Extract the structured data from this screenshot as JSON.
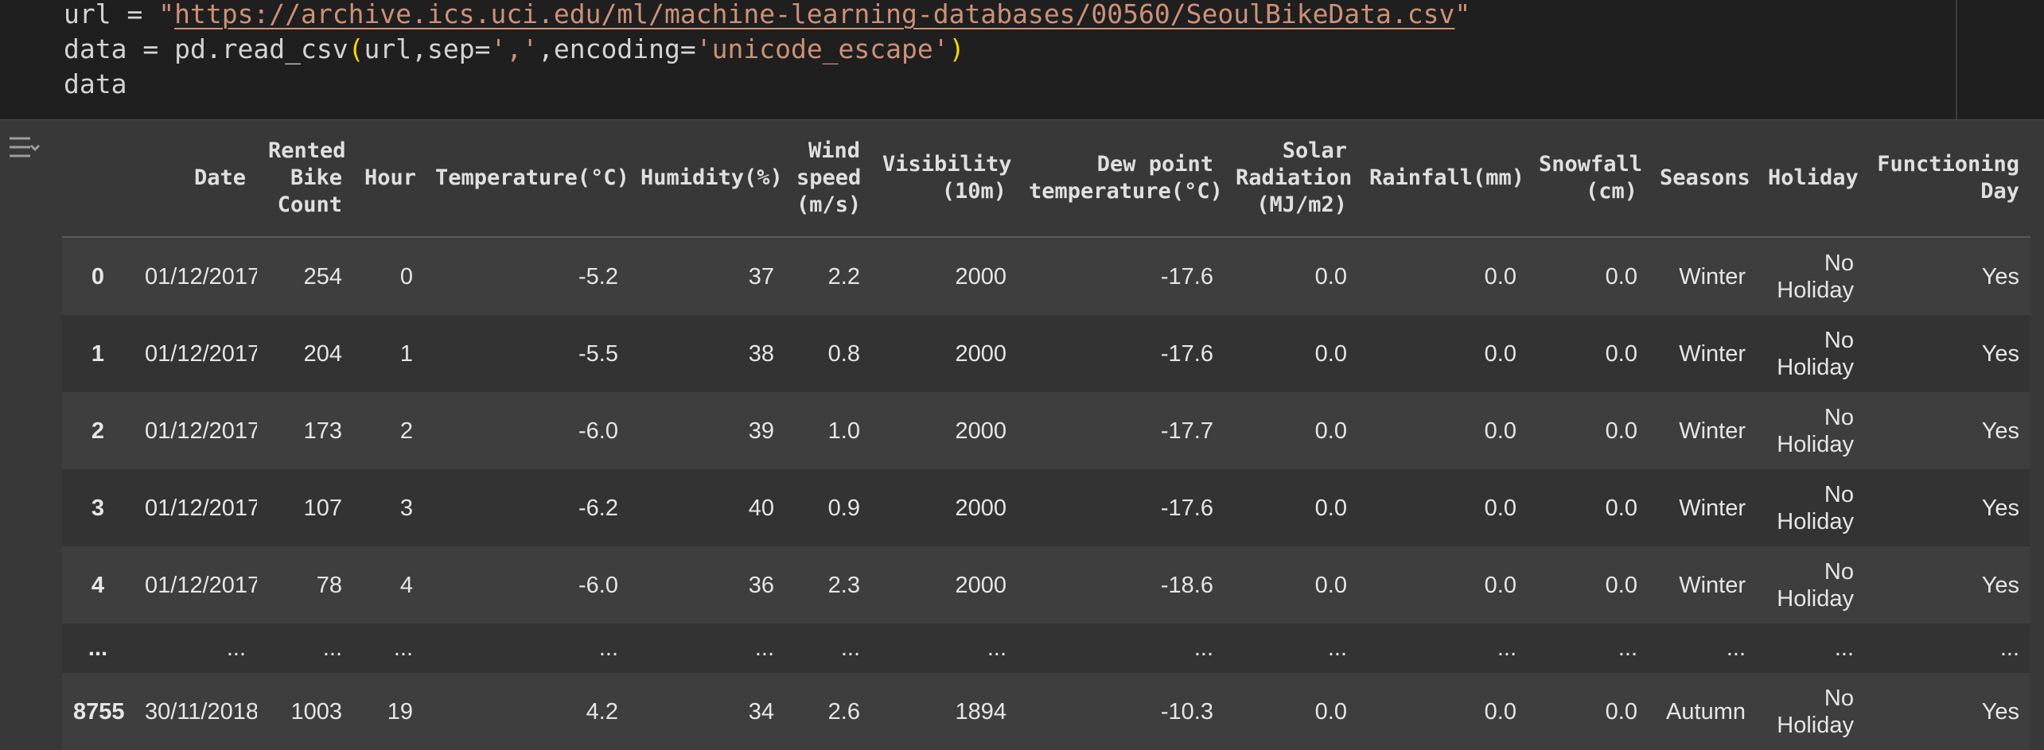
{
  "code": {
    "line1": {
      "var": "url = ",
      "q1": "\"",
      "url": "https://archive.ics.uci.edu/ml/machine-learning-databases/00560/SeoulBikeData.csv",
      "q2": "\""
    },
    "line2": {
      "pre": "data = pd.read_csv",
      "open": "(",
      "args_pre": "url,sep=",
      "sep": "','",
      "mid": ",encoding=",
      "enc": "'unicode_escape'",
      "close": ")"
    },
    "line3": "data"
  },
  "output_toggle_icon": "output-collapse-icon",
  "table": {
    "headers": [
      "",
      "Date",
      "Rented Bike Count",
      "Hour",
      "Temperature(°C)",
      "Humidity(%)",
      "Wind speed (m/s)",
      "Visibility (10m)",
      "Dew point temperature(°C)",
      "Solar Radiation (MJ/m2)",
      "Rainfall(mm)",
      "Snowfall (cm)",
      "Seasons",
      "Holiday",
      "Functioning Day"
    ],
    "rows": [
      {
        "index": "0",
        "cells": [
          "01/12/2017",
          "254",
          "0",
          "-5.2",
          "37",
          "2.2",
          "2000",
          "-17.6",
          "0.0",
          "0.0",
          "0.0",
          "Winter",
          "No Holiday",
          "Yes"
        ]
      },
      {
        "index": "1",
        "cells": [
          "01/12/2017",
          "204",
          "1",
          "-5.5",
          "38",
          "0.8",
          "2000",
          "-17.6",
          "0.0",
          "0.0",
          "0.0",
          "Winter",
          "No Holiday",
          "Yes"
        ]
      },
      {
        "index": "2",
        "cells": [
          "01/12/2017",
          "173",
          "2",
          "-6.0",
          "39",
          "1.0",
          "2000",
          "-17.7",
          "0.0",
          "0.0",
          "0.0",
          "Winter",
          "No Holiday",
          "Yes"
        ]
      },
      {
        "index": "3",
        "cells": [
          "01/12/2017",
          "107",
          "3",
          "-6.2",
          "40",
          "0.9",
          "2000",
          "-17.6",
          "0.0",
          "0.0",
          "0.0",
          "Winter",
          "No Holiday",
          "Yes"
        ]
      },
      {
        "index": "4",
        "cells": [
          "01/12/2017",
          "78",
          "4",
          "-6.0",
          "36",
          "2.3",
          "2000",
          "-18.6",
          "0.0",
          "0.0",
          "0.0",
          "Winter",
          "No Holiday",
          "Yes"
        ]
      },
      {
        "index": "...",
        "cells": [
          "...",
          "...",
          "...",
          "...",
          "...",
          "...",
          "...",
          "...",
          "...",
          "...",
          "...",
          "...",
          "...",
          "..."
        ]
      },
      {
        "index": "8755",
        "cells": [
          "30/11/2018",
          "1003",
          "19",
          "4.2",
          "34",
          "2.6",
          "1894",
          "-10.3",
          "0.0",
          "0.0",
          "0.0",
          "Autumn",
          "No Holiday",
          "Yes"
        ]
      }
    ]
  }
}
